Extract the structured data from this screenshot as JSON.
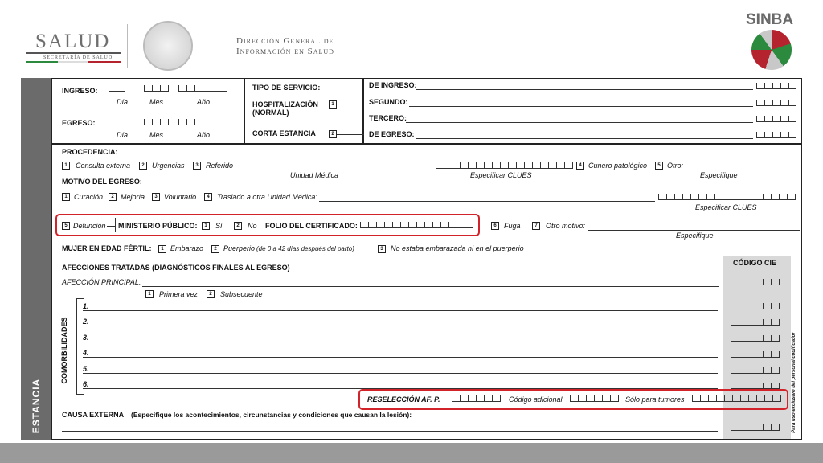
{
  "header": {
    "salud_logo": "SALUD",
    "secretaria": "SECRETARÍA DE SALUD",
    "dgis_line1": "Dirección General de",
    "dgis_line2": "Información en Salud",
    "sinba": "SINBA",
    "accent_red": "#d2232a",
    "sidebar_color": "#6b6b6b"
  },
  "sidebar_label": "ESTANCIA",
  "form": {
    "ingreso": "INGRESO:",
    "egreso": "EGRESO:",
    "dia": "Día",
    "mes": "Mes",
    "anio": "Año",
    "tipo_servicio": "TIPO DE SERVICIO:",
    "hosp_normal_1": "HOSPITALIZACIÓN",
    "hosp_normal_2": "(NORMAL)",
    "corta_estancia": "CORTA ESTANCIA",
    "box1": "1",
    "box2": "2",
    "de_ingreso": "DE INGRESO:",
    "segundo": "SEGUNDO:",
    "tercero": "TERCERO:",
    "de_egreso": "DE EGRESO:",
    "procedencia": "PROCEDENCIA:",
    "proc_opts": [
      "Consulta externa",
      "Urgencias",
      "Referido"
    ],
    "unidad_medica": "Unidad Médica",
    "especificar_clues": "Especificar CLUES",
    "cunero": "Cunero patológico",
    "otro": "Otro:",
    "especifique": "Especifique",
    "motivo_egreso": "MOTIVO DEL EGRESO:",
    "mot_opts": [
      "Curación",
      "Mejoría",
      "Voluntario",
      "Traslado a otra Unidad Médica:"
    ],
    "especificar_clues2": "Especificar CLUES",
    "defuncion": "Defunción",
    "ministerio": "MINISTERIO PÚBLICO:",
    "si": "Sí",
    "no": "No",
    "folio": "FOLIO DEL CERTIFICADO:",
    "fuga": "Fuga",
    "otro_motivo": "Otro motivo:",
    "especifique2": "Especifique",
    "mujer_fertil": "MUJER EN EDAD FÉRTIL:",
    "embarazo": "Embarazo",
    "puerperio": "Puerperio",
    "puerperio_detail": "(de 0 a 42 días después del parto)",
    "no_embarazada": "No estaba embarazada ni en el puerperio",
    "afecciones": "AFECCIONES TRATADAS  (DIAGNÓSTICOS FINALES AL EGRESO)",
    "codigo_cie": "CÓDIGO CIE",
    "afeccion_principal": "AFECCIÓN PRINCIPAL:",
    "primera_vez": "Primera vez",
    "subsecuente": "Subsecuente",
    "comorbilidades": "COMORBILIDADES",
    "nums": [
      "1.",
      "2.",
      "3.",
      "4.",
      "5.",
      "6."
    ],
    "reseleccion": "RESELECCIÓN  AF. P.",
    "codigo_adicional": "Código adicional",
    "solo_tumores": "Sólo para tumores",
    "causa_externa": "CAUSA EXTERNA",
    "causa_detail": "(Especifique los acontecimientos, circunstancias y condiciones que causan la lesión):",
    "uso_exclusivo": "Para uso exclusivo del personal codificador",
    "nums_box": [
      "1",
      "2",
      "3",
      "4",
      "5",
      "6",
      "7"
    ]
  }
}
